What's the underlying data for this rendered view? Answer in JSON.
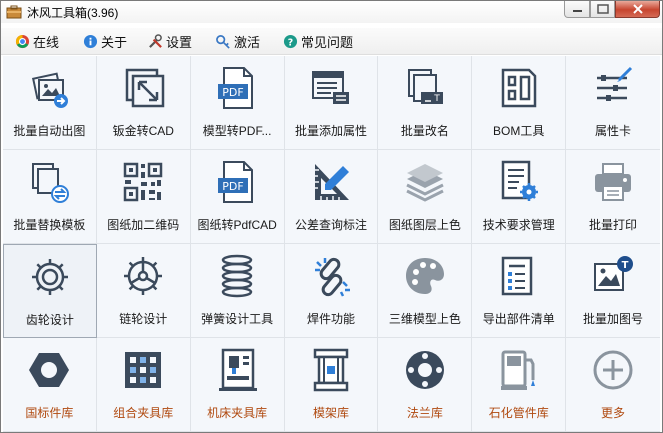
{
  "window": {
    "title": "沐风工具箱(3.96)"
  },
  "menu": [
    {
      "label": "在线",
      "icon": "chrome-icon"
    },
    {
      "label": "关于",
      "icon": "info-icon"
    },
    {
      "label": "设置",
      "icon": "tools-icon"
    },
    {
      "label": "激活",
      "icon": "key-icon"
    },
    {
      "label": "常见问题",
      "icon": "help-icon"
    }
  ],
  "tools": [
    {
      "label": "批量自动出图",
      "icon": "auto-drawing-icon"
    },
    {
      "label": "钣金转CAD",
      "icon": "sheetmetal-icon"
    },
    {
      "label": "模型转PDF...",
      "icon": "pdf-icon"
    },
    {
      "label": "批量添加属性",
      "icon": "add-property-icon"
    },
    {
      "label": "批量改名",
      "icon": "rename-icon"
    },
    {
      "label": "BOM工具",
      "icon": "bom-icon"
    },
    {
      "label": "属性卡",
      "icon": "property-card-icon"
    },
    {
      "label": "批量替换模板",
      "icon": "replace-template-icon"
    },
    {
      "label": "图纸加二维码",
      "icon": "qrcode-icon"
    },
    {
      "label": "图纸转PdfCAD",
      "icon": "pdf-icon"
    },
    {
      "label": "公差查询标注",
      "icon": "triangle-ruler-icon"
    },
    {
      "label": "图纸图层上色",
      "icon": "layers-icon"
    },
    {
      "label": "技术要求管理",
      "icon": "tech-requirements-icon"
    },
    {
      "label": "批量打印",
      "icon": "printer-icon"
    },
    {
      "label": "齿轮设计",
      "icon": "gear-icon"
    },
    {
      "label": "链轮设计",
      "icon": "sprocket-icon"
    },
    {
      "label": "弹簧设计工具",
      "icon": "spring-icon"
    },
    {
      "label": "焊件功能",
      "icon": "weldment-icon"
    },
    {
      "label": "三维模型上色",
      "icon": "palette-icon"
    },
    {
      "label": "导出部件清单",
      "icon": "parts-list-icon"
    },
    {
      "label": "批量加图号",
      "icon": "add-drawing-number-icon"
    },
    {
      "label": "国标件库",
      "icon": "hex-nut-icon"
    },
    {
      "label": "组合夹具库",
      "icon": "fixture-plate-icon"
    },
    {
      "label": "机床夹具库",
      "icon": "machine-fixture-icon"
    },
    {
      "label": "模架库",
      "icon": "mold-base-icon"
    },
    {
      "label": "法兰库",
      "icon": "flange-icon"
    },
    {
      "label": "石化管件库",
      "icon": "petro-pipe-icon"
    },
    {
      "label": "更多",
      "icon": "plus-circle-icon"
    }
  ],
  "selected_tool": "齿轮设计",
  "colors": {
    "icon": "#3b4a5c",
    "accent_blue": "#2f7fd8",
    "library_label": "#b04a10"
  }
}
